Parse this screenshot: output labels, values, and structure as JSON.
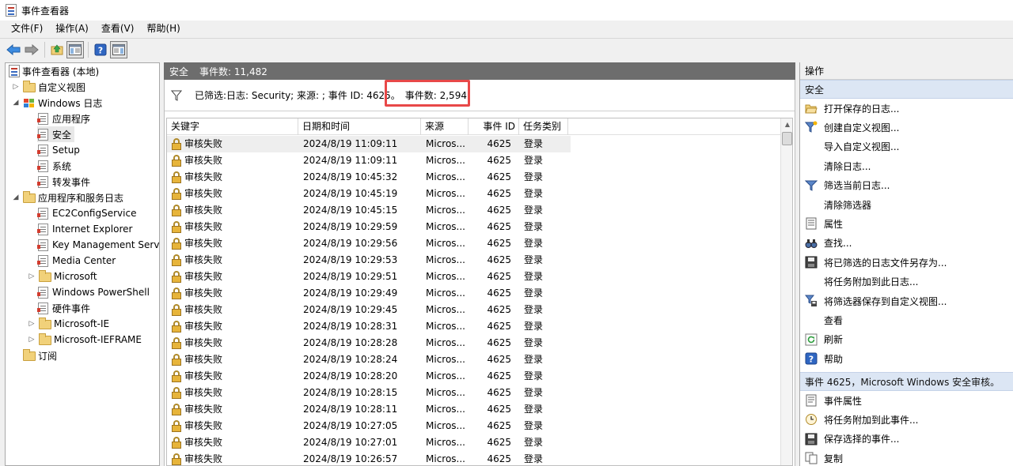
{
  "window": {
    "title": "事件查看器"
  },
  "menu": [
    "文件(F)",
    "操作(A)",
    "查看(V)",
    "帮助(H)"
  ],
  "tree": {
    "root": "事件查看器 (本地)",
    "custom_views": "自定义视图",
    "windows_logs": "Windows 日志",
    "windows_log_items": [
      "应用程序",
      "安全",
      "Setup",
      "系统",
      "转发事件"
    ],
    "app_logs": "应用程序和服务日志",
    "app_log_items": [
      "EC2ConfigService",
      "Internet Explorer",
      "Key Management Serv",
      "Media Center",
      "Microsoft",
      "Windows PowerShell",
      "硬件事件",
      "Microsoft-IE",
      "Microsoft-IEFRAME"
    ],
    "subscriptions": "订阅"
  },
  "center": {
    "log_name": "安全",
    "event_count": "事件数: 11,482",
    "filter_text": "已筛选:日志: Security; 来源: ; 事件 ID: 4625。",
    "filtered_count": "事件数: 2,594",
    "columns": [
      "关键字",
      "日期和时间",
      "来源",
      "事件 ID",
      "任务类别"
    ],
    "rows": [
      [
        "审核失败",
        "2024/8/19 11:09:11",
        "Micros...",
        "4625",
        "登录"
      ],
      [
        "审核失败",
        "2024/8/19 11:09:11",
        "Micros...",
        "4625",
        "登录"
      ],
      [
        "审核失败",
        "2024/8/19 10:45:32",
        "Micros...",
        "4625",
        "登录"
      ],
      [
        "审核失败",
        "2024/8/19 10:45:19",
        "Micros...",
        "4625",
        "登录"
      ],
      [
        "审核失败",
        "2024/8/19 10:45:15",
        "Micros...",
        "4625",
        "登录"
      ],
      [
        "审核失败",
        "2024/8/19 10:29:59",
        "Micros...",
        "4625",
        "登录"
      ],
      [
        "审核失败",
        "2024/8/19 10:29:56",
        "Micros...",
        "4625",
        "登录"
      ],
      [
        "审核失败",
        "2024/8/19 10:29:53",
        "Micros...",
        "4625",
        "登录"
      ],
      [
        "审核失败",
        "2024/8/19 10:29:51",
        "Micros...",
        "4625",
        "登录"
      ],
      [
        "审核失败",
        "2024/8/19 10:29:49",
        "Micros...",
        "4625",
        "登录"
      ],
      [
        "审核失败",
        "2024/8/19 10:29:45",
        "Micros...",
        "4625",
        "登录"
      ],
      [
        "审核失败",
        "2024/8/19 10:28:31",
        "Micros...",
        "4625",
        "登录"
      ],
      [
        "审核失败",
        "2024/8/19 10:28:28",
        "Micros...",
        "4625",
        "登录"
      ],
      [
        "审核失败",
        "2024/8/19 10:28:24",
        "Micros...",
        "4625",
        "登录"
      ],
      [
        "审核失败",
        "2024/8/19 10:28:20",
        "Micros...",
        "4625",
        "登录"
      ],
      [
        "审核失败",
        "2024/8/19 10:28:15",
        "Micros...",
        "4625",
        "登录"
      ],
      [
        "审核失败",
        "2024/8/19 10:28:11",
        "Micros...",
        "4625",
        "登录"
      ],
      [
        "审核失败",
        "2024/8/19 10:27:05",
        "Micros...",
        "4625",
        "登录"
      ],
      [
        "审核失败",
        "2024/8/19 10:27:01",
        "Micros...",
        "4625",
        "登录"
      ],
      [
        "审核失败",
        "2024/8/19 10:26:57",
        "Micros...",
        "4625",
        "登录"
      ]
    ]
  },
  "actions": {
    "header": "操作",
    "section1": "安全",
    "items1": [
      {
        "label": "打开保存的日志...",
        "icon": "open-folder-icon"
      },
      {
        "label": "创建自定义视图...",
        "icon": "create-filter-icon"
      },
      {
        "label": "导入自定义视图...",
        "icon": ""
      },
      {
        "label": "清除日志...",
        "icon": ""
      },
      {
        "label": "筛选当前日志...",
        "icon": "filter-icon"
      },
      {
        "label": "清除筛选器",
        "icon": ""
      },
      {
        "label": "属性",
        "icon": "properties-icon"
      },
      {
        "label": "查找...",
        "icon": "binoculars-icon"
      },
      {
        "label": "将已筛选的日志文件另存为...",
        "icon": "save-icon"
      },
      {
        "label": "将任务附加到此日志...",
        "icon": ""
      },
      {
        "label": "将筛选器保存到自定义视图...",
        "icon": "save-filter-icon"
      },
      {
        "label": "查看",
        "icon": ""
      },
      {
        "label": "刷新",
        "icon": "refresh-icon"
      },
      {
        "label": "帮助",
        "icon": "help-icon"
      }
    ],
    "section2": "事件 4625，Microsoft Windows 安全审核。",
    "items2": [
      {
        "label": "事件属性",
        "icon": "event-properties-icon"
      },
      {
        "label": "将任务附加到此事件...",
        "icon": "task-icon"
      },
      {
        "label": "保存选择的事件...",
        "icon": "save-icon"
      },
      {
        "label": "复制",
        "icon": "copy-icon"
      }
    ]
  }
}
